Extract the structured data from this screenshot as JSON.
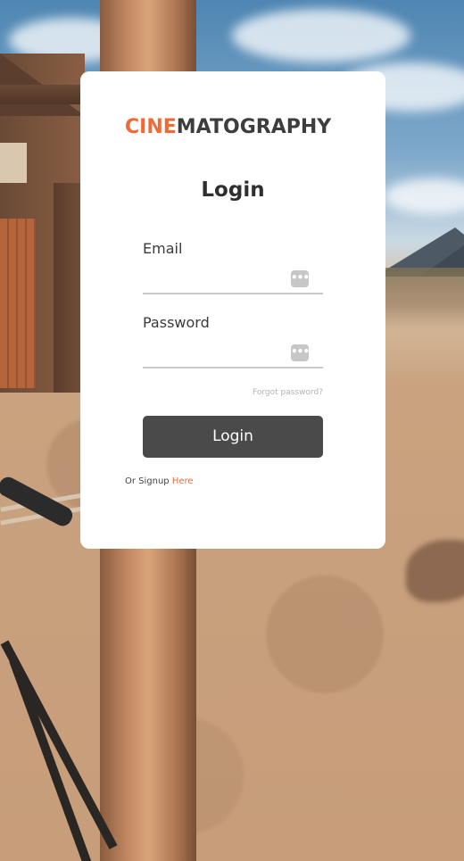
{
  "brand": {
    "accent": "CINE",
    "rest": "MATOGRAPHY",
    "accent_color": "#ee6a36"
  },
  "login_form": {
    "title": "Login",
    "email_label": "Email",
    "email_value": "",
    "email_icon": "password-manager-icon",
    "password_label": "Password",
    "password_value": "",
    "password_icon": "password-manager-icon",
    "forgot_password": "Forgot password?",
    "submit_label": "Login",
    "button_color": "#4a4a4a"
  },
  "signup": {
    "prefix": "Or Signup",
    "link": "Here"
  },
  "icons": {
    "password_manager_glyph": "•••"
  }
}
